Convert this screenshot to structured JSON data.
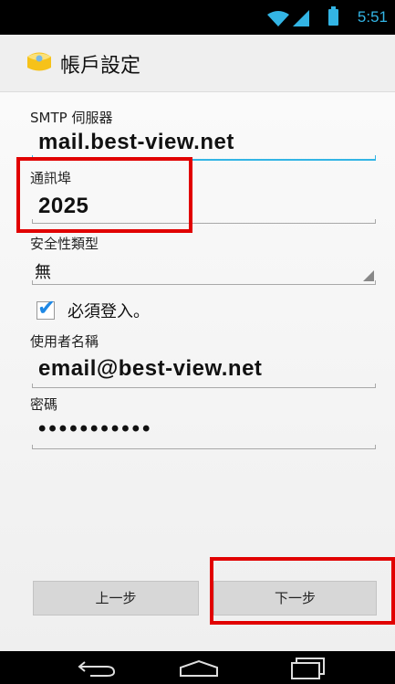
{
  "status_bar": {
    "time": "5:51"
  },
  "header": {
    "title": "帳戶設定"
  },
  "form": {
    "smtp_server_label": "SMTP 伺服器",
    "smtp_server_value": "mail.best-view.net",
    "port_label": "通訊埠",
    "port_value": "2025",
    "security_type_label": "安全性類型",
    "security_type_value": "無",
    "require_signin_label": "必須登入。",
    "require_signin_checked": true,
    "username_label": "使用者名稱",
    "username_value": "email@best-view.net",
    "password_label": "密碼",
    "password_value": "•••••••••••"
  },
  "buttons": {
    "previous_label": "上一步",
    "next_label": "下一步"
  },
  "colors": {
    "accent": "#33b5e5",
    "highlight_box": "#e10000",
    "checkmark": "#1e88e5"
  },
  "icons": [
    "wifi-icon",
    "signal-icon",
    "battery-icon",
    "email-app-icon",
    "back-icon",
    "home-icon",
    "recents-icon"
  ]
}
